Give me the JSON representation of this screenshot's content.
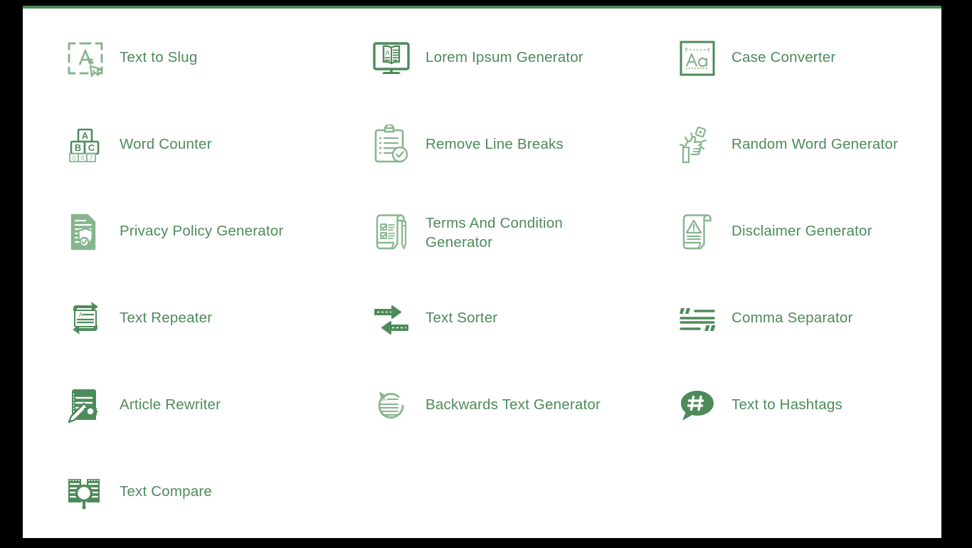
{
  "theme": {
    "accent": "#4e8b5a",
    "accent_light": "#87b58e",
    "page_background": "#ffffff",
    "frame_background": "#000000",
    "top_rule": "#4a8a56"
  },
  "tools": [
    {
      "label": "Text to Slug",
      "icon": "text-to-slug-icon",
      "two_line": false
    },
    {
      "label": "Lorem Ipsum Generator",
      "icon": "monitor-book-icon",
      "two_line": false
    },
    {
      "label": "Case Converter",
      "icon": "case-converter-aa-box-icon",
      "two_line": false
    },
    {
      "label": "Word Counter",
      "icon": "abc-blocks-counter-icon",
      "two_line": false
    },
    {
      "label": "Remove Line Breaks",
      "icon": "clipboard-check-lines-icon",
      "two_line": false
    },
    {
      "label": "Random Word Generator",
      "icon": "hand-tossing-dice-icon",
      "two_line": false
    },
    {
      "label": "Privacy Policy Generator",
      "icon": "document-shield-check-icon",
      "two_line": false
    },
    {
      "label": "Terms And Condition Generator",
      "icon": "contract-checkboxes-pen-icon",
      "two_line": true
    },
    {
      "label": "Disclaimer Generator",
      "icon": "scroll-warning-icon",
      "two_line": false
    },
    {
      "label": "Text Repeater",
      "icon": "repeat-arrows-document-icon",
      "two_line": false
    },
    {
      "label": "Text Sorter",
      "icon": "two-way-arrows-icon",
      "two_line": false
    },
    {
      "label": "Comma Separator",
      "icon": "quotation-marks-lines-icon",
      "two_line": false
    },
    {
      "label": "Article Rewriter",
      "icon": "document-pencil-gear-icon",
      "two_line": false
    },
    {
      "label": "Backwards Text Generator",
      "icon": "circular-arrow-document-icon",
      "two_line": false
    },
    {
      "label": "Text to Hashtags",
      "icon": "speech-bubble-hashtag-icon",
      "two_line": false
    },
    {
      "label": "Text Compare",
      "icon": "documents-magnifier-icon",
      "two_line": false
    }
  ]
}
